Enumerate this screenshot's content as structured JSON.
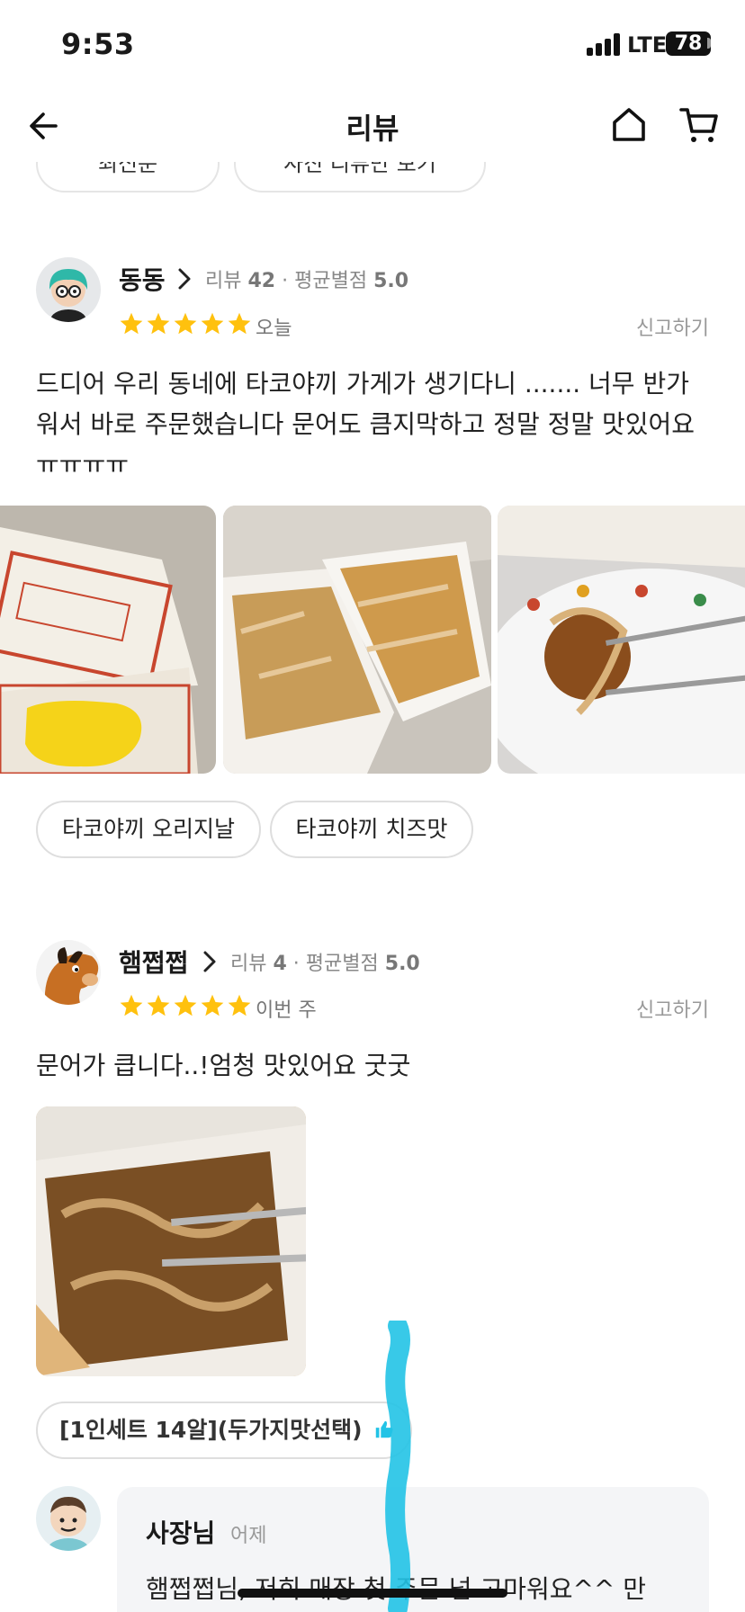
{
  "status_bar": {
    "time": "9:53",
    "network": "LTE",
    "battery": "78"
  },
  "header": {
    "title": "리뷰",
    "back_icon": "arrow-left-icon",
    "home_icon": "home-icon",
    "cart_icon": "cart-icon"
  },
  "filters": [
    {
      "label": "최신순"
    },
    {
      "label": "사진 리뷰만 보기"
    }
  ],
  "reviews": [
    {
      "name": "동동",
      "review_label": "리뷰",
      "review_count": "42",
      "rating_label": "평균별점",
      "rating": "5.0",
      "stars": 5,
      "date": "오늘",
      "report": "신고하기",
      "body": "드디어 우리 동네에 타코야끼 가게가 생기다니 ....... 너무 반가워서 바로 주문했습니다 문어도 큼지막하고 정말 정말 맛있어요ㅠㅠㅠㅠ",
      "photos": 3,
      "tags": [
        "타코야끼 오리지날",
        "타코야끼 치즈맛"
      ]
    },
    {
      "name": "햄쩝쩝",
      "review_label": "리뷰",
      "review_count": "4",
      "rating_label": "평균별점",
      "rating": "5.0",
      "stars": 5,
      "date": "이번 주",
      "report": "신고하기",
      "body": "문어가 큽니다..!엄청 맛있어요 굿굿",
      "photos": 1,
      "tags": [
        "[1인세트 14알](두가지맛선택)"
      ]
    }
  ],
  "owner_reply": {
    "name": "사장님",
    "date": "어제",
    "text": "햄쩝쩝님, 저희 매장 첫 주문 넘 고마워요^^ 만"
  },
  "colors": {
    "star": "#FFC10E",
    "accent": "#22C3E6",
    "chip_border": "#DEDEDE"
  }
}
